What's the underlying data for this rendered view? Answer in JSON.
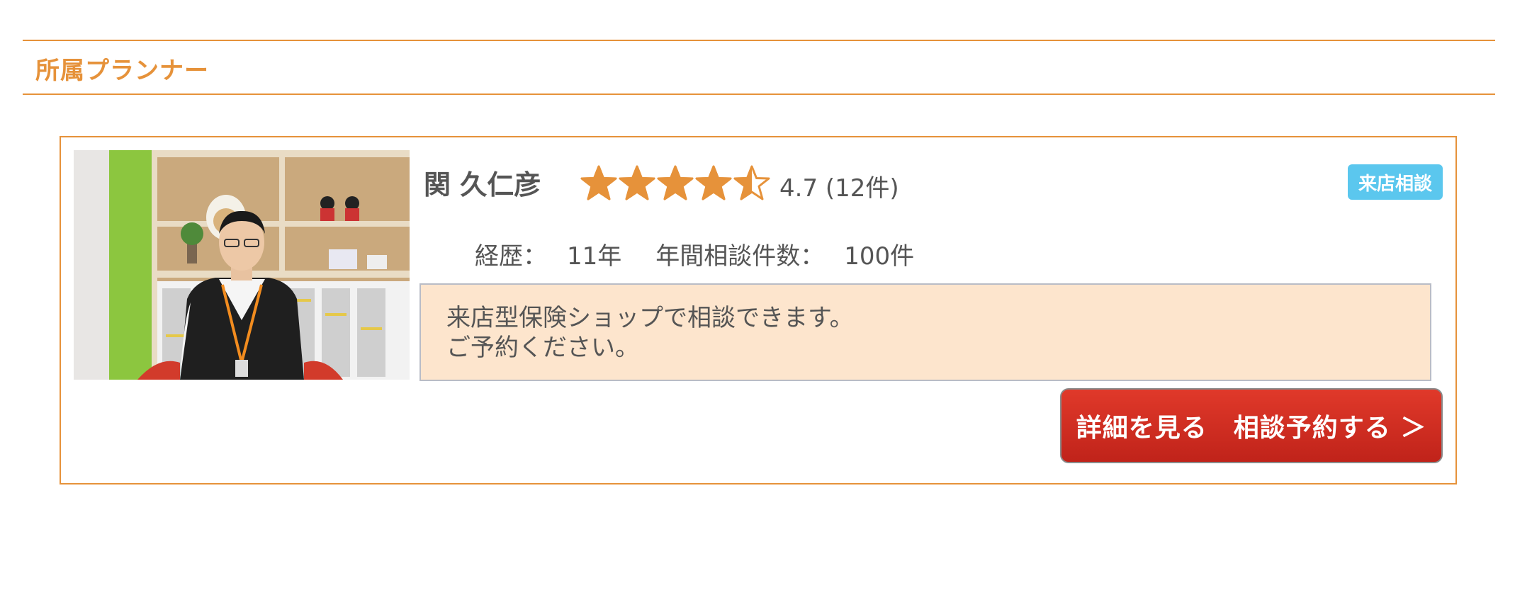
{
  "section": {
    "title": "所属プランナー"
  },
  "planner": {
    "name": "関 久仁彦",
    "rating": 4.7,
    "rating_text": "4.7 (12件)",
    "star_color": "#e6923a",
    "badge": "来店相談",
    "badge_color": "#5bc7ee",
    "career_label": "経歴：",
    "career_value": "11年",
    "consult_label": "年間相談件数：",
    "consult_value": "100件",
    "message_line1": "来店型保険ショップで相談できます。",
    "message_line2": "ご予約ください。",
    "cta_label": "詳細を見る　相談予約する ＞",
    "cta_color": "#d32f23",
    "accent_color": "#e6923a"
  }
}
